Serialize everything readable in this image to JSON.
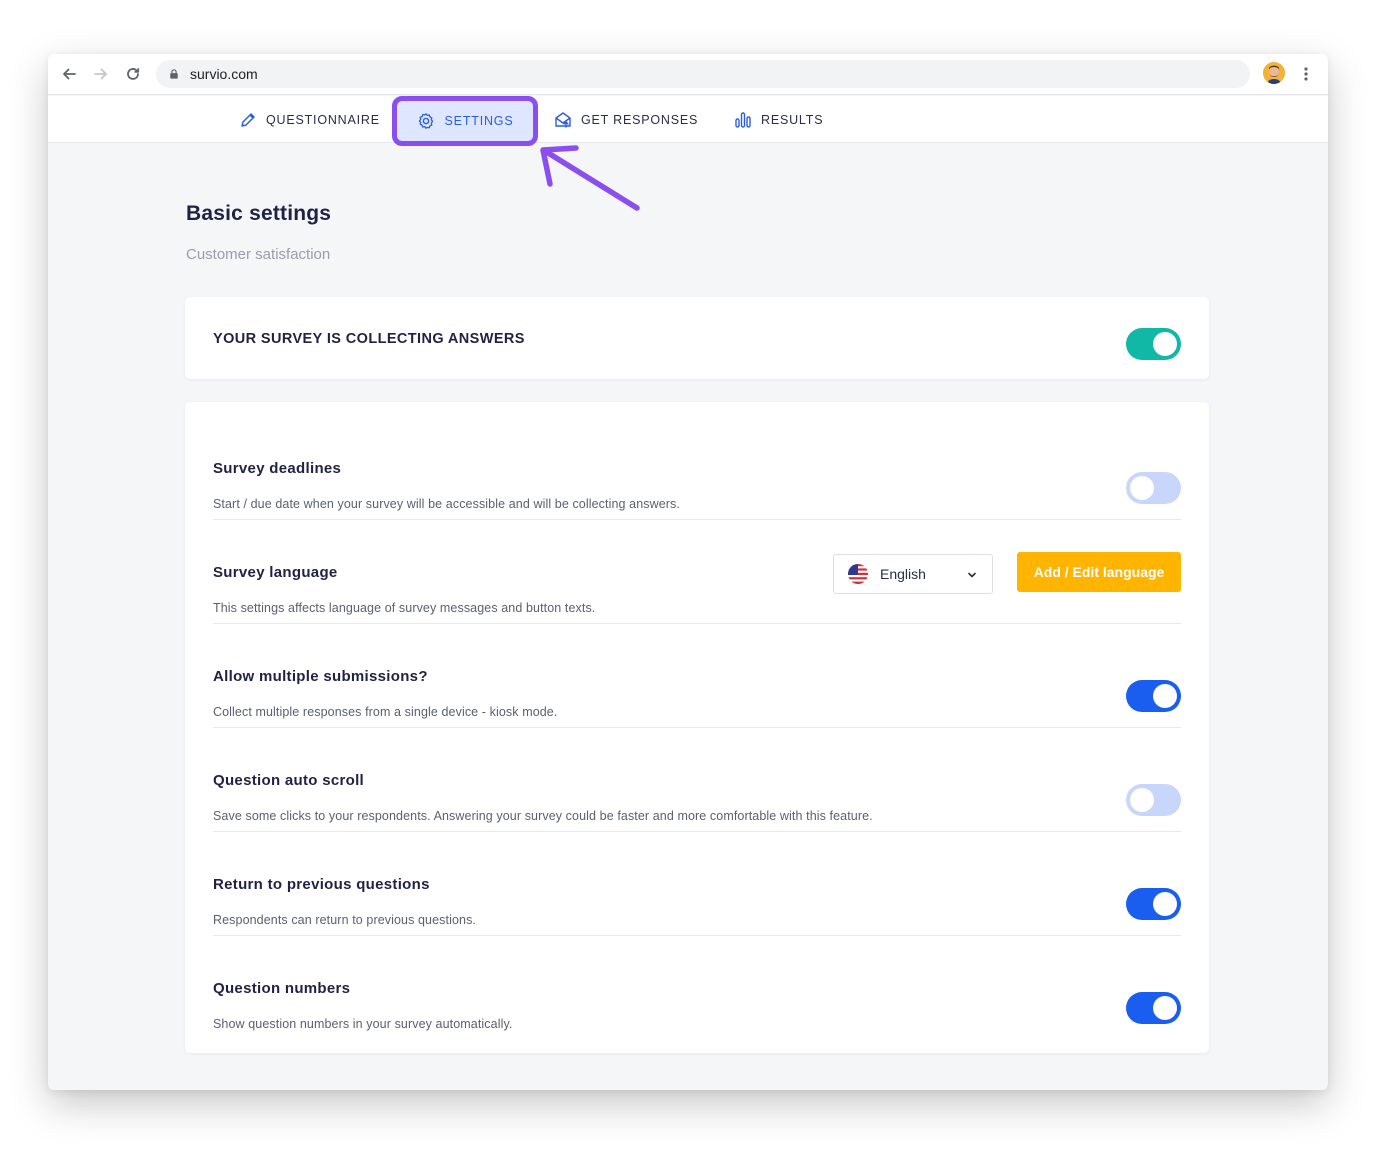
{
  "browser": {
    "url": "survio.com"
  },
  "tabs": [
    {
      "label": "QUESTIONNAIRE",
      "icon": "pencil-icon"
    },
    {
      "label": "SETTINGS",
      "icon": "gear-icon",
      "active": true
    },
    {
      "label": "GET RESPONSES",
      "icon": "envelope-share-icon"
    },
    {
      "label": "RESULTS",
      "icon": "bar-chart-icon"
    }
  ],
  "page": {
    "title": "Basic settings",
    "subtitle": "Customer satisfaction"
  },
  "collecting": {
    "label": "YOUR SURVEY IS COLLECTING ANSWERS",
    "enabled": true
  },
  "settings": [
    {
      "title": "Survey deadlines",
      "description": "Start / due date when your survey will be accessible and will be collecting answers.",
      "enabled": false
    },
    {
      "title": "Survey language",
      "description": "This settings affects language of survey messages and button texts.",
      "language": "English",
      "button": "Add / Edit language"
    },
    {
      "title": "Allow multiple submissions?",
      "description": "Collect multiple responses from a single device - kiosk mode.",
      "enabled": true
    },
    {
      "title": "Question auto scroll",
      "description": "Save some clicks to your respondents. Answering your survey could be faster and more comfortable with this feature.",
      "enabled": false
    },
    {
      "title": "Return to previous questions",
      "description": "Respondents can return to previous questions.",
      "enabled": true
    },
    {
      "title": "Question numbers",
      "description": "Show question numbers in your survey automatically.",
      "enabled": true
    }
  ],
  "colors": {
    "accent": "#1a5ef0",
    "teal": "#12b8a6",
    "highlight": "#8b4ff0",
    "button": "#ffb400"
  }
}
